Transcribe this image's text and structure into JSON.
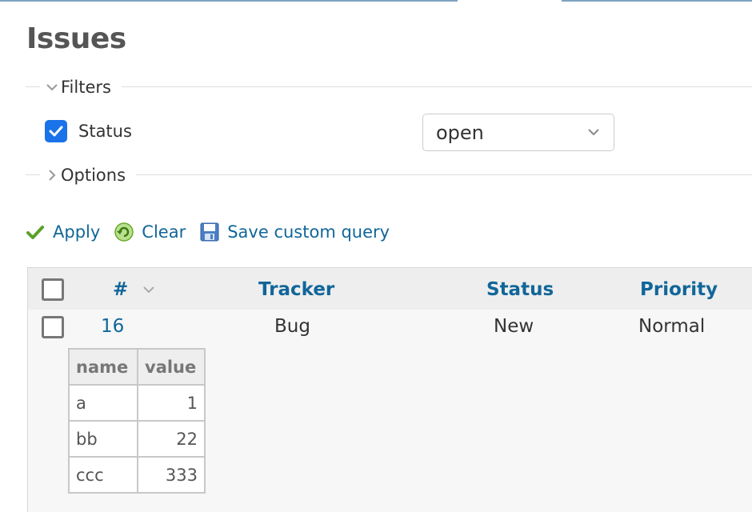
{
  "page": {
    "title": "Issues"
  },
  "filters": {
    "legend": "Filters",
    "status_label": "Status",
    "status_checked": true,
    "status_value": "open"
  },
  "options": {
    "legend": "Options"
  },
  "actions": {
    "apply": "Apply",
    "clear": "Clear",
    "save": "Save custom query"
  },
  "list": {
    "columns": {
      "id": "#",
      "tracker": "Tracker",
      "status": "Status",
      "priority": "Priority"
    },
    "rows": [
      {
        "id": "16",
        "tracker": "Bug",
        "status": "New",
        "priority": "Normal"
      }
    ]
  },
  "description_table": {
    "headers": [
      "name",
      "value"
    ],
    "rows": [
      {
        "name": "a",
        "value": "1"
      },
      {
        "name": "bb",
        "value": "22"
      },
      {
        "name": "ccc",
        "value": "333"
      }
    ]
  },
  "colors": {
    "link": "#116699",
    "checkbox": "#1a73e8",
    "apply_icon": "#5aa02c"
  }
}
